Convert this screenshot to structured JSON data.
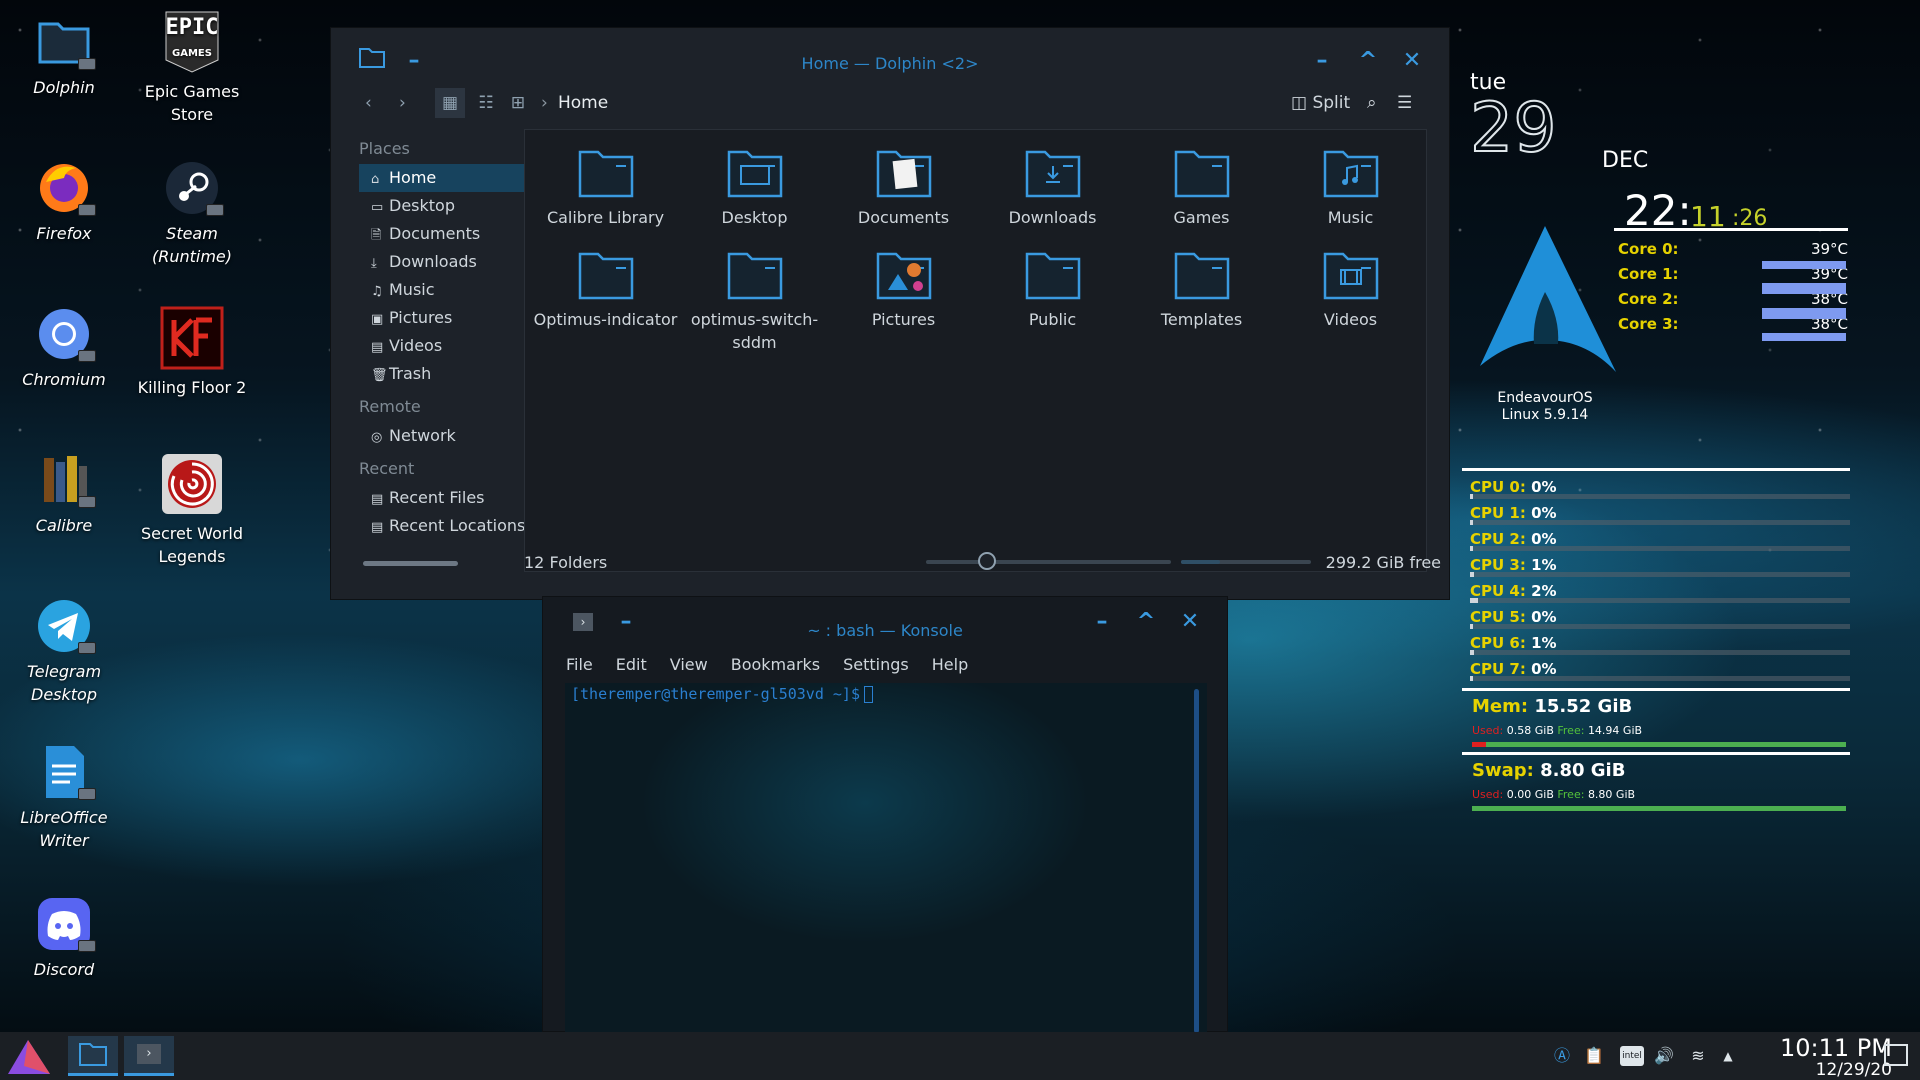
{
  "desktop": {
    "icons": [
      {
        "label": "Dolphin"
      },
      {
        "label": "Epic Games Store"
      },
      {
        "label": "Firefox"
      },
      {
        "label": "Steam (Runtime)"
      },
      {
        "label": "Chromium"
      },
      {
        "label": "Killing Floor 2"
      },
      {
        "label": "Calibre"
      },
      {
        "label": "Secret World Legends"
      },
      {
        "label": "Telegram Desktop"
      },
      {
        "label": "LibreOffice Writer"
      },
      {
        "label": "Discord"
      }
    ],
    "epic_logo_text": "EPIC",
    "epic_logo_sub": "GAMES"
  },
  "dolphin": {
    "title": "Home — Dolphin <2>",
    "split_label": "Split",
    "breadcrumb": "Home",
    "places_header": "Places",
    "places": [
      {
        "label": "Home",
        "icon": "⌂"
      },
      {
        "label": "Desktop",
        "icon": "▭"
      },
      {
        "label": "Documents",
        "icon": "🗎"
      },
      {
        "label": "Downloads",
        "icon": "⤓"
      },
      {
        "label": "Music",
        "icon": "♫"
      },
      {
        "label": "Pictures",
        "icon": "▣"
      },
      {
        "label": "Videos",
        "icon": "▤"
      },
      {
        "label": "Trash",
        "icon": "🗑"
      }
    ],
    "remote_header": "Remote",
    "remote": [
      {
        "label": "Network",
        "icon": "◎"
      }
    ],
    "recent_header": "Recent",
    "recent": [
      {
        "label": "Recent Files",
        "icon": "▤"
      },
      {
        "label": "Recent Locations",
        "icon": "▤"
      }
    ],
    "folders": [
      {
        "label": "Calibre Library",
        "icon": "folder-icon"
      },
      {
        "label": "Desktop",
        "icon": "desktop-folder-icon"
      },
      {
        "label": "Documents",
        "icon": "documents-folder-icon"
      },
      {
        "label": "Downloads",
        "icon": "downloads-folder-icon"
      },
      {
        "label": "Games",
        "icon": "folder-icon"
      },
      {
        "label": "Music",
        "icon": "music-folder-icon"
      },
      {
        "label": "Optimus-indicator",
        "icon": "folder-icon"
      },
      {
        "label": "optimus-switch-sddm",
        "icon": "folder-icon"
      },
      {
        "label": "Pictures",
        "icon": "pictures-folder-icon"
      },
      {
        "label": "Public",
        "icon": "folder-icon"
      },
      {
        "label": "Templates",
        "icon": "folder-icon"
      },
      {
        "label": "Videos",
        "icon": "videos-folder-icon"
      }
    ],
    "status_text": "12 Folders",
    "free_space": "299.2 GiB free",
    "disk_used_fraction": 0.3,
    "zoom_fraction": 0.25
  },
  "konsole": {
    "title": "~ : bash — Konsole",
    "menu": [
      "File",
      "Edit",
      "View",
      "Bookmarks",
      "Settings",
      "Help"
    ],
    "prompt": "[theremper@theremper-gl503vd ~]$"
  },
  "conky": {
    "day": "tue",
    "date": "29",
    "month": "DEC",
    "time_h": "22:",
    "time_m": "11",
    "time_s": ":26",
    "cores": [
      {
        "label": "Core 0:",
        "temp": "39°C"
      },
      {
        "label": "Core 1:",
        "temp": "39°C"
      },
      {
        "label": "Core 2:",
        "temp": "38°C"
      },
      {
        "label": "Core 3:",
        "temp": "38°C"
      }
    ],
    "distro_name": "EndeavourOS",
    "kernel": "Linux 5.9.14",
    "cpus": [
      {
        "label": "CPU 0:",
        "value": "0%",
        "pct": 0
      },
      {
        "label": "CPU 1:",
        "value": "0%",
        "pct": 0
      },
      {
        "label": "CPU 2:",
        "value": "0%",
        "pct": 0
      },
      {
        "label": "CPU 3:",
        "value": "1%",
        "pct": 1
      },
      {
        "label": "CPU 4:",
        "value": "2%",
        "pct": 2
      },
      {
        "label": "CPU 5:",
        "value": "0%",
        "pct": 0
      },
      {
        "label": "CPU 6:",
        "value": "1%",
        "pct": 1
      },
      {
        "label": "CPU 7:",
        "value": "0%",
        "pct": 0
      }
    ],
    "mem": {
      "label": "Mem:",
      "total": "15.52 GiB",
      "used_label": "Used:",
      "used": "0.58 GiB",
      "free_label": "Free:",
      "free": "14.94 GiB",
      "used_fraction": 0.037
    },
    "swap": {
      "label": "Swap:",
      "total": "8.80 GiB",
      "used_label": "Used:",
      "used": "0.00 GiB",
      "free_label": "Free:",
      "free": "8.80 GiB",
      "used_fraction": 0.0
    }
  },
  "taskbar": {
    "time": "10:11 PM",
    "date": "12/29/20"
  },
  "colors": {
    "accent": "#3a9ae0",
    "conky_label": "#e6d200",
    "mem_used": "#e02020",
    "mem_free": "#4caf50"
  }
}
